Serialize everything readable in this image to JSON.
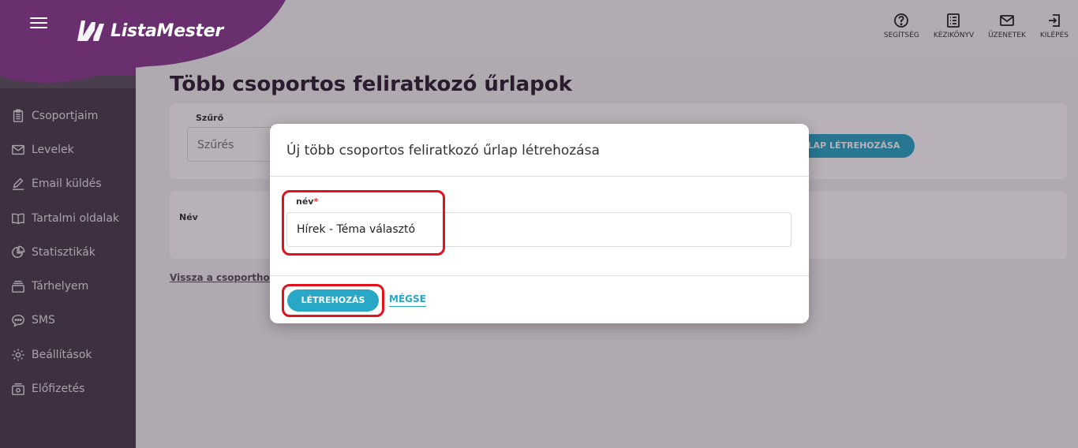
{
  "brand": {
    "name": "ListaMester",
    "header_color": "#6a2f6f",
    "sidebar_color": "#4a3e4e",
    "accent": "#27a8c6",
    "highlight": "#e2111b"
  },
  "sidebar": {
    "items": [
      {
        "label": "Csoportjaim",
        "icon": "clipboard-icon"
      },
      {
        "label": "Levelek",
        "icon": "mail-icon"
      },
      {
        "label": "Email küldés",
        "icon": "pen-icon"
      },
      {
        "label": "Tartalmi oldalak",
        "icon": "book-icon"
      },
      {
        "label": "Statisztikák",
        "icon": "pie-chart-icon"
      },
      {
        "label": "Tárhelyem",
        "icon": "storage-icon"
      },
      {
        "label": "SMS",
        "icon": "chat-icon"
      },
      {
        "label": "Beállítások",
        "icon": "gear-icon"
      },
      {
        "label": "Előfizetés",
        "icon": "subscription-icon"
      }
    ]
  },
  "header": {
    "actions": [
      {
        "label": "SEGÍTSÉG",
        "icon": "help-icon"
      },
      {
        "label": "KÉZIKÖNYV",
        "icon": "manual-icon"
      },
      {
        "label": "ÜZENETEK",
        "icon": "messages-icon"
      },
      {
        "label": "KILÉPÉS",
        "icon": "logout-icon"
      }
    ]
  },
  "main": {
    "title": "Több csoportos feliratkozó űrlapok",
    "filter_label": "Szűrő",
    "filter_placeholder": "Szűrés",
    "create_button": "LAP LÉTREHOZÁSA",
    "table_col_name": "Név",
    "back_link": "Vissza a csoporthoz"
  },
  "modal": {
    "title": "Új több csoportos feliratkozó űrlap létrehozása",
    "field_label": "név",
    "field_required": "*",
    "field_value": "Hírek - Téma választó",
    "submit": "LÉTREHOZÁS",
    "cancel": "MÉGSE"
  }
}
